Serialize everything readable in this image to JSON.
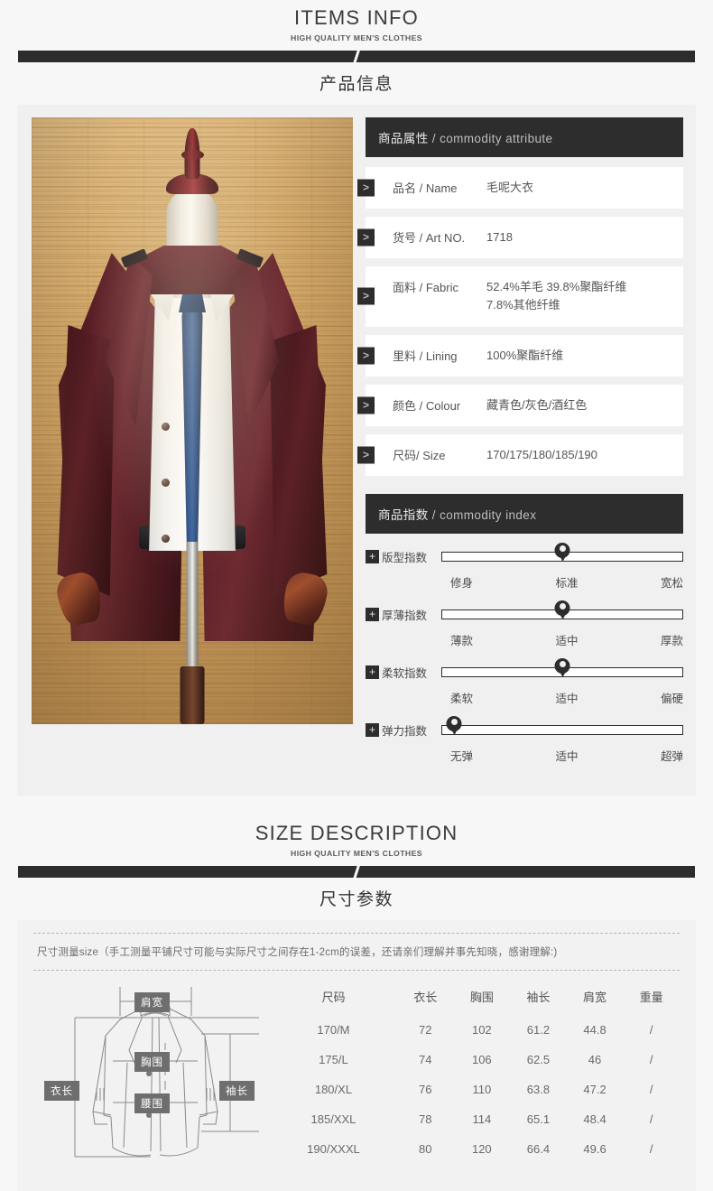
{
  "sections": {
    "items_info": {
      "title": "ITEMS INFO",
      "subtitle": "HIGH QUALITY MEN'S CLOTHES",
      "cn_title": "产品信息"
    },
    "size_description": {
      "title": "SIZE DESCRIPTION",
      "subtitle": "HIGH QUALITY MEN'S CLOTHES",
      "cn_title": "尺寸参数"
    }
  },
  "commodity_attribute": {
    "header_cn": "商品属性",
    "header_sep": " / ",
    "header_en": "commodity attribute",
    "rows": [
      {
        "label": "品名 / Name",
        "value": [
          "毛呢大衣"
        ]
      },
      {
        "label": "货号 / Art NO.",
        "value": [
          "1718"
        ]
      },
      {
        "label": "面料 / Fabric",
        "value": [
          "52.4%羊毛  39.8%聚酯纤维",
          "7.8%其他纤维"
        ]
      },
      {
        "label": "里料 / Lining",
        "value": [
          "100%聚酯纤维"
        ]
      },
      {
        "label": "颜色 / Colour",
        "value": [
          "藏青色/灰色/酒红色"
        ]
      },
      {
        "label": "尺码/ Size",
        "value": [
          "170/175/180/185/190"
        ]
      }
    ],
    "marker_icon": "chevron-right-icon"
  },
  "commodity_index": {
    "header_cn": "商品指数",
    "header_sep": " / ",
    "header_en": "commodity index",
    "plus_icon": "plus-icon",
    "rows": [
      {
        "name": "版型指数",
        "position_pct": 50,
        "scale": [
          "修身",
          "标准",
          "宽松"
        ]
      },
      {
        "name": "厚薄指数",
        "position_pct": 50,
        "scale": [
          "薄款",
          "适中",
          "厚款"
        ]
      },
      {
        "name": "柔软指数",
        "position_pct": 50,
        "scale": [
          "柔软",
          "适中",
          "偏硬"
        ]
      },
      {
        "name": "弹力指数",
        "position_pct": 5,
        "scale": [
          "无弹",
          "适中",
          "超弹"
        ]
      }
    ]
  },
  "size_section": {
    "note": "尺寸测量size（手工测量平铺尺寸可能与实际尺寸之间存在1-2cm的误差，还请亲们理解并事先知晓，感谢理解:)",
    "diagram_labels": {
      "shoulder": "肩宽",
      "chest": "胸围",
      "waist": "腰围",
      "length": "衣长",
      "sleeve": "袖长"
    },
    "table": {
      "headers": [
        "尺码",
        "衣长",
        "胸围",
        "袖长",
        "肩宽",
        "重量"
      ],
      "rows": [
        [
          "170/M",
          "72",
          "102",
          "61.2",
          "44.8",
          "/"
        ],
        [
          "175/L",
          "74",
          "106",
          "62.5",
          "46",
          "/"
        ],
        [
          "180/XL",
          "76",
          "110",
          "63.8",
          "47.2",
          "/"
        ],
        [
          "185/XXL",
          "78",
          "114",
          "65.1",
          "48.4",
          "/"
        ],
        [
          "190/XXXL",
          "80",
          "120",
          "66.4",
          "49.6",
          "/"
        ]
      ]
    }
  },
  "colors": {
    "dark": "#2d2d2d",
    "panel": "#f0f0f0",
    "page": "#f7f7f7",
    "coat": "#5d2027",
    "label_badge": "#6e6e6e"
  }
}
